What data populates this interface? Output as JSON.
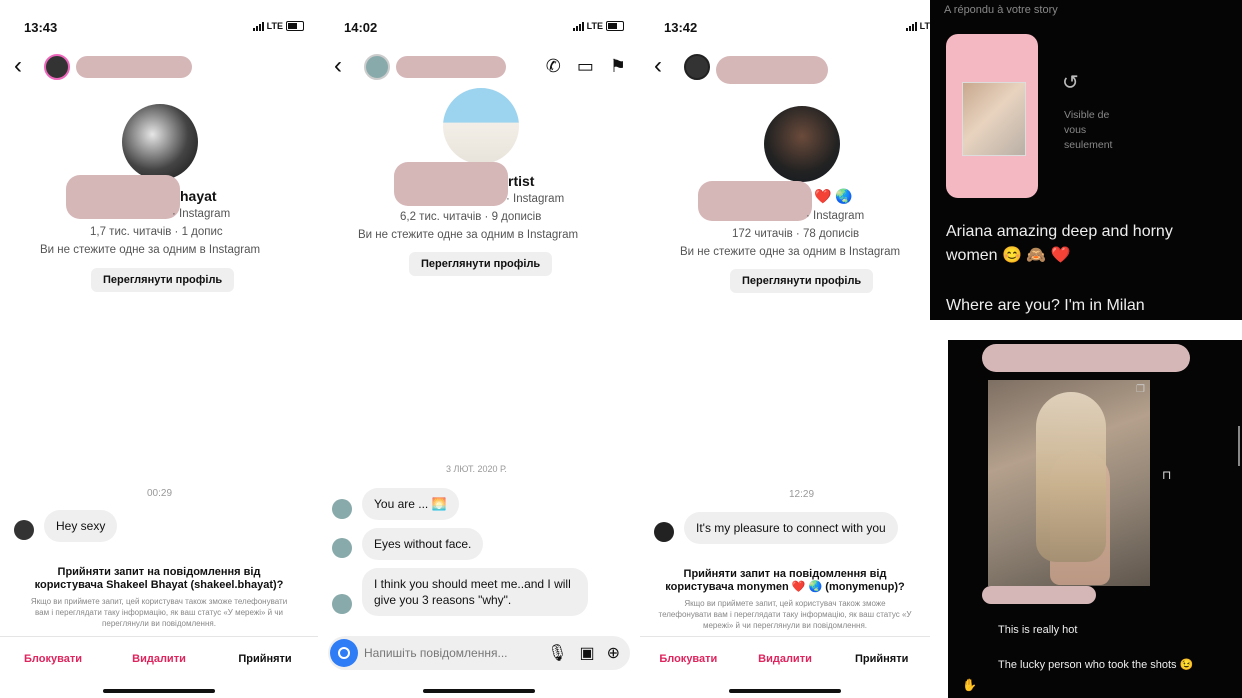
{
  "panel1": {
    "time": "13:43",
    "network": "LTE",
    "name_suffix": "hayat",
    "handle_line": "· Instagram",
    "stats": "1,7 тис. читачів · 1 допис",
    "follow_status": "Ви не стежите одне за одним в Instagram",
    "view_profile": "Переглянути профіль",
    "timestamp": "00:29",
    "message": "Hey sexy",
    "request_title": "Прийняти запит на повідомлення від користувача Shakeel Bhayat (shakeel.bhayat)?",
    "request_note": "Якщо ви приймете запит, цей користувач також зможе телефонувати вам і переглядати таку інформацію, як ваш статус «У мережі» й чи переглянули ви повідомлення.",
    "actions": [
      "Блокувати",
      "Видалити",
      "Прийняти"
    ]
  },
  "panel2": {
    "time": "14:02",
    "network": "LTE",
    "name_suffix": "rtist",
    "handle_line": "· Instagram",
    "stats": "6,2 тис. читачів · 9 дописів",
    "follow_status": "Ви не стежите одне за одним в Instagram",
    "view_profile": "Переглянути профіль",
    "date": "3 ЛЮТ. 2020 Р.",
    "messages": [
      "You are ... 🌅",
      "Eyes without face.",
      "I think you should meet me..and I will give you 3 reasons \"why\"."
    ],
    "composer_placeholder": "Напишіть повідомлення..."
  },
  "panel3": {
    "time": "13:42",
    "network": "LTE",
    "name_suffix": "❤️ 🌏",
    "handle_line": "· Instagram",
    "stats": "172 читачів · 78 дописів",
    "follow_status": "Ви не стежите одне за одним в Instagram",
    "view_profile": "Переглянути профіль",
    "timestamp": "12:29",
    "message": "It's my pleasure to connect with you",
    "request_title": "Прийняти запит на повідомлення від користувача monymen ❤️ 🌏 (monymenup)?",
    "request_note": "Якщо ви приймете запит, цей користувач також зможе телефонувати вам і переглядати таку інформацію, як ваш статус «У мережі» й чи переглянули ви повідомлення.",
    "actions": [
      "Блокувати",
      "Видалити",
      "Прийняти"
    ]
  },
  "dark_top": {
    "header": "A répondu à votre story",
    "visibility": "Visible de vous seulement",
    "message1": "Ariana amazing deep and horny women 😊 🙈 ❤️",
    "message2": "Where are you? I'm in Milan"
  },
  "dark_bottom": {
    "comment1": "This is really hot",
    "comment2": "The lucky person who took the shots 😉"
  }
}
